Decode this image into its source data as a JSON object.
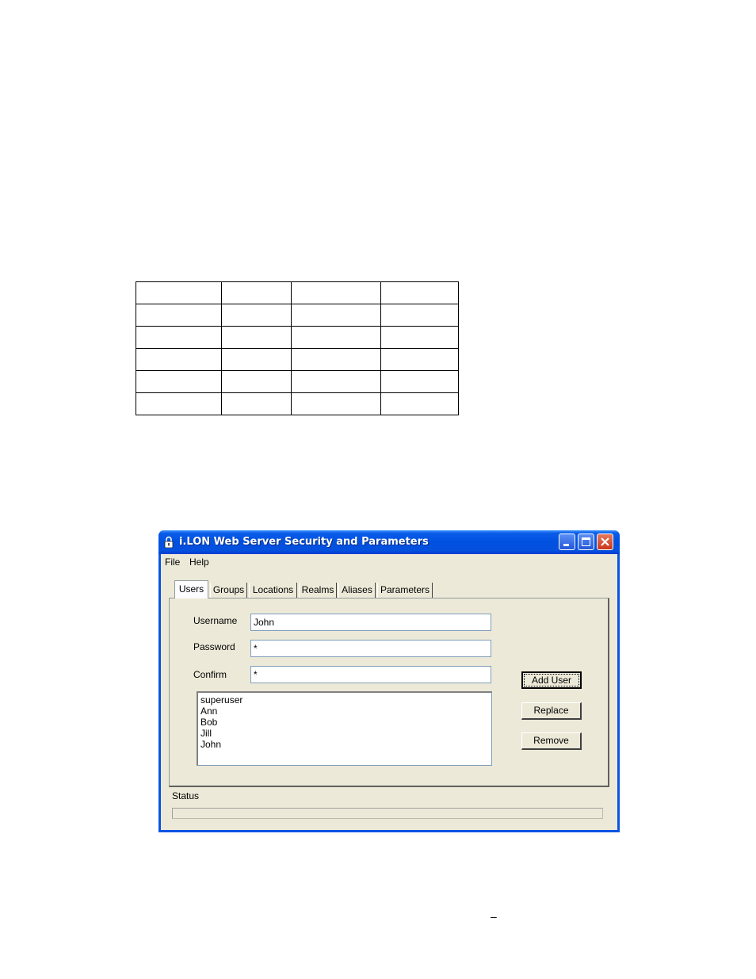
{
  "window": {
    "title": "i.LON Web Server Security and Parameters",
    "accent": "#0054e3"
  },
  "menu": {
    "items": [
      "File",
      "Help"
    ]
  },
  "tabs": [
    "Users",
    "Groups",
    "Locations",
    "Realms",
    "Aliases",
    "Parameters"
  ],
  "active_tab": "Users",
  "form": {
    "username_label": "Username",
    "username_value": "John",
    "password_label": "Password",
    "password_value": "*",
    "confirm_label": "Confirm",
    "confirm_value": "*"
  },
  "user_list": [
    "superuser",
    "Ann",
    "Bob",
    "Jill",
    "John"
  ],
  "buttons": {
    "add_user": "Add User",
    "replace": "Replace",
    "remove": "Remove"
  },
  "status": {
    "label": "Status",
    "value": ""
  },
  "page": {
    "dash": "–"
  }
}
